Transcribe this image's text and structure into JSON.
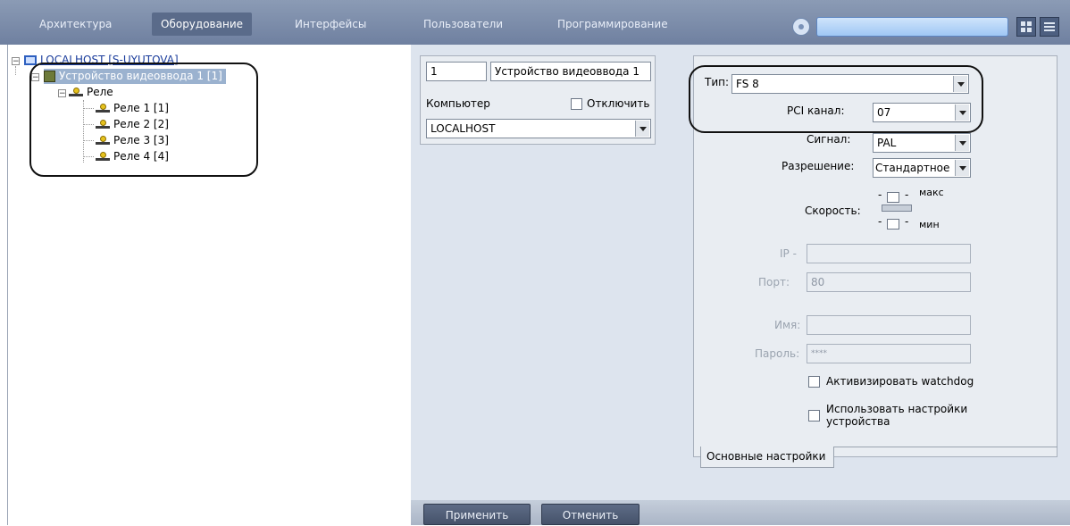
{
  "topnav": {
    "tabs": [
      "Архитектура",
      "Оборудование",
      "Интерфейсы",
      "Пользователи",
      "Программирование"
    ],
    "active_tab": "Оборудование"
  },
  "tree": {
    "root_label": "LOCALHOST [S-UYUTOVA]",
    "device_label": "Устройство видеоввода 1 [1]",
    "group_label": "Реле",
    "relays": [
      "Реле 1 [1]",
      "Реле 2 [2]",
      "Реле 3 [3]",
      "Реле 4 [4]"
    ]
  },
  "device": {
    "id": "1",
    "name": "Устройство видеоввода 1",
    "computer_label": "Компьютер",
    "disable_label": "Отключить",
    "computer_value": "LOCALHOST"
  },
  "settings": {
    "type_label": "Тип:",
    "type_value": "FS 8",
    "pci_label": "PCI канал:",
    "pci_value": "07",
    "signal_label": "Сигнал:",
    "signal_value": "PAL",
    "resolution_label": "Разрешение:",
    "resolution_value": "Стандартное",
    "speed_label": "Скорость:",
    "speed_max": "макс",
    "speed_min": "мин",
    "ip_label": "IP -",
    "ip_value": "",
    "port_label": "Порт:",
    "port_value": "80",
    "name_label": "Имя:",
    "name_value": "",
    "password_label": "Пароль:",
    "password_value": "****",
    "watchdog_label": "Активизировать watchdog",
    "use_device_settings_line1": "Использовать настройки",
    "use_device_settings_line2": "устройства",
    "tab_label": "Основные настройки"
  },
  "footer": {
    "apply_label": "Применить",
    "cancel_label": "Отменить"
  }
}
